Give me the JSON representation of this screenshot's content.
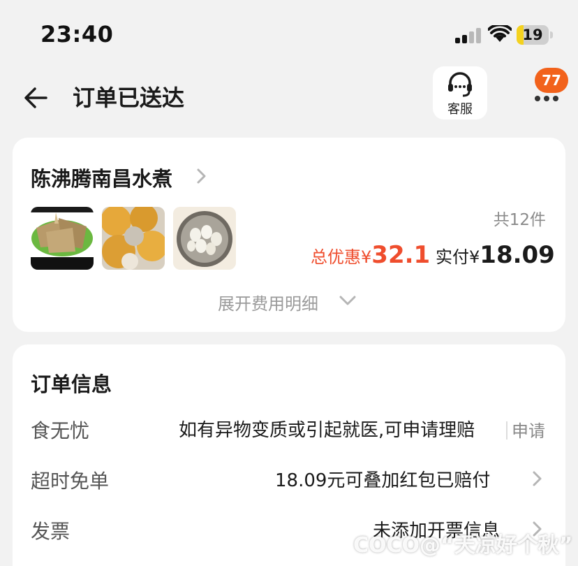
{
  "status_bar": {
    "time": "23:40",
    "battery_level": "19",
    "battery_color": "#f4d21f"
  },
  "header": {
    "title": "订单已送达",
    "service_label": "客服",
    "notification_count": "77",
    "back_icon": "arrow-left-icon",
    "service_icon": "headset-icon",
    "more_icon": "more-dots-icon"
  },
  "shop_card": {
    "shop_name": "陈沸腾南昌水煮",
    "item_count": "共12件",
    "discount_label": "总优惠¥",
    "discount_value": "32.1",
    "paid_label": "实付¥",
    "paid_value": "18.09",
    "expand_label": "展开费用明细",
    "accent_color": "#ef4d2d"
  },
  "order_info": {
    "title": "订单信息",
    "rows": [
      {
        "label": "食无忧",
        "value": "如有异物变质或引起就医,可申请理赔",
        "action": "申请"
      },
      {
        "label": "超时免单",
        "value": "18.09元可叠加红包已赔付"
      },
      {
        "label": "发票",
        "value": "未添加开票信息"
      }
    ]
  },
  "watermark": "COCO@“天凉好个秋”"
}
